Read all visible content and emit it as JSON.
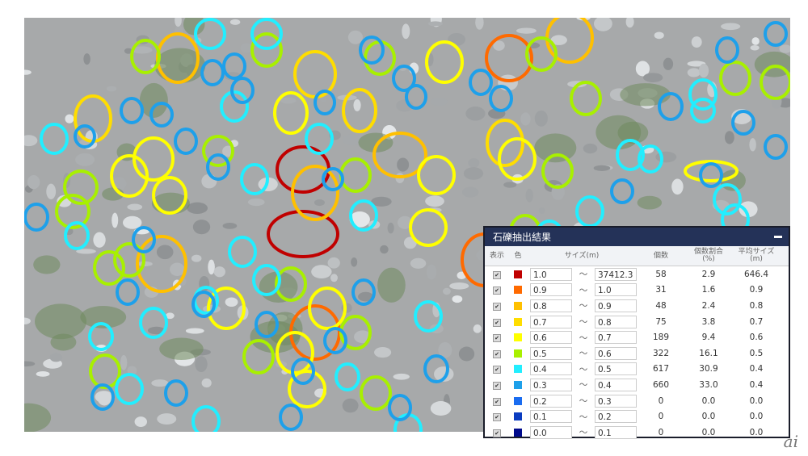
{
  "panel": {
    "title": "石礫抽出結果",
    "minimize_icon": "minus-icon",
    "headers": {
      "show": "表示",
      "color": "色",
      "size": "サイズ(m)",
      "count": "個数",
      "ratio": "個数割合\n(%)",
      "avg": "平均サイズ\n(m)"
    },
    "rows": [
      {
        "color": "#c00000",
        "from": "1.0",
        "sep": "〜",
        "to": "37412.3",
        "count": "58",
        "ratio": "2.9",
        "avg": "646.4"
      },
      {
        "color": "#ff6a00",
        "from": "0.9",
        "sep": "〜",
        "to": "1.0",
        "count": "31",
        "ratio": "1.6",
        "avg": "0.9"
      },
      {
        "color": "#ffc000",
        "from": "0.8",
        "sep": "〜",
        "to": "0.9",
        "count": "48",
        "ratio": "2.4",
        "avg": "0.8"
      },
      {
        "color": "#ffdd00",
        "from": "0.7",
        "sep": "〜",
        "to": "0.8",
        "count": "75",
        "ratio": "3.8",
        "avg": "0.7"
      },
      {
        "color": "#ffff00",
        "from": "0.6",
        "sep": "〜",
        "to": "0.7",
        "count": "189",
        "ratio": "9.4",
        "avg": "0.6"
      },
      {
        "color": "#a8f000",
        "from": "0.5",
        "sep": "〜",
        "to": "0.6",
        "count": "322",
        "ratio": "16.1",
        "avg": "0.5"
      },
      {
        "color": "#22eeff",
        "from": "0.4",
        "sep": "〜",
        "to": "0.5",
        "count": "617",
        "ratio": "30.9",
        "avg": "0.4"
      },
      {
        "color": "#1ea0ea",
        "from": "0.3",
        "sep": "〜",
        "to": "0.4",
        "count": "660",
        "ratio": "33.0",
        "avg": "0.4"
      },
      {
        "color": "#1a6cf0",
        "from": "0.2",
        "sep": "〜",
        "to": "0.3",
        "count": "0",
        "ratio": "0.0",
        "avg": "0.0"
      },
      {
        "color": "#0a3cc0",
        "from": "0.1",
        "sep": "〜",
        "to": "0.2",
        "count": "0",
        "ratio": "0.0",
        "avg": "0.0"
      },
      {
        "color": "#000a8c",
        "from": "0.0",
        "sep": "〜",
        "to": "0.1",
        "count": "0",
        "ratio": "0.0",
        "avg": "0.0"
      }
    ]
  },
  "logo": "ai"
}
